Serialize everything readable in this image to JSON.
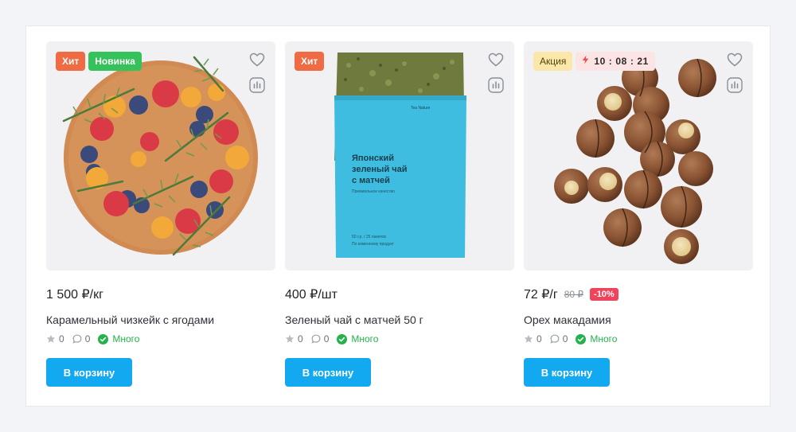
{
  "products": [
    {
      "badges": [
        "Хит",
        "Новинка"
      ],
      "price": "1 500 ₽/кг",
      "name": "Карамельный чизкейк с ягодами",
      "rating": "0",
      "reviews": "0",
      "stock": "Много",
      "cart_label": "В корзину"
    },
    {
      "badges": [
        "Хит"
      ],
      "price": "400 ₽/шт",
      "name": "Зеленый чай с матчей 50 г",
      "rating": "0",
      "reviews": "0",
      "stock": "Много",
      "cart_label": "В корзину",
      "package": {
        "brand": "Tea Nature",
        "title_lines": [
          "Японский",
          "зеленый чай",
          "с матчей"
        ],
        "subtitle": "Премиальное качество",
        "weight_line": "50 г.р. / 25 пакетов",
        "bottom_line": "По изменному продукт"
      }
    },
    {
      "badges": [
        "Акция"
      ],
      "timer": "10 : 08 : 21",
      "price": "72 ₽/г",
      "old_price": "80 ₽",
      "discount": "-10%",
      "name": "Орех макадамия",
      "rating": "0",
      "reviews": "0",
      "stock": "Много",
      "cart_label": "В корзину"
    }
  ],
  "colors": {
    "accent": "#13a9f0",
    "hit": "#f06a43",
    "new": "#35c25a",
    "sale": "#fbe7a9",
    "discount": "#f0435c",
    "stock": "#24b34a"
  },
  "icons": [
    "heart-icon",
    "compare-chart-icon",
    "star-icon",
    "comment-icon",
    "check-circle-icon",
    "lightning-icon"
  ]
}
